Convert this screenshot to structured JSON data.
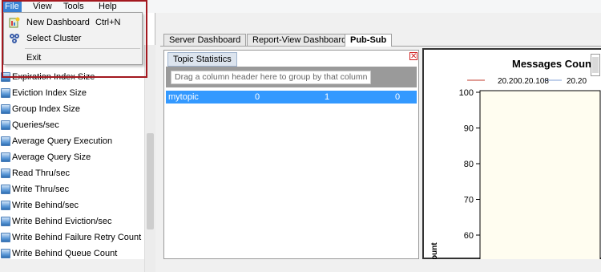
{
  "menubar": {
    "items": [
      "File",
      "View",
      "Tools",
      "Help"
    ]
  },
  "file_menu": {
    "items": [
      {
        "label": "New Dashboard",
        "shortcut": "Ctrl+N",
        "icon": "new-dashboard-icon"
      },
      {
        "label": "Select Cluster",
        "shortcut": "",
        "icon": "cluster-icon"
      },
      {
        "label": "Exit",
        "shortcut": "",
        "icon": ""
      }
    ]
  },
  "counters": {
    "items": [
      "Expiration Index Size",
      "Eviction Index Size",
      "Group Index Size",
      "Queries/sec",
      "Average Query Execution",
      "Average Query Size",
      "Read Thru/sec",
      "Write Thru/sec",
      "Write Behind/sec",
      "Write Behind Eviction/sec",
      "Write Behind Failure Retry Count",
      "Write Behind Queue Count"
    ]
  },
  "tabs": [
    "Server Dashboard",
    "Report-View Dashboard",
    "Pub-Sub"
  ],
  "topic_stats": {
    "title": "Topic Statistics",
    "group_hint": "Drag a column header here to group by that column",
    "rows": [
      {
        "topic": "mytopic",
        "c1": "0",
        "c2": "1",
        "c3": "0"
      }
    ]
  },
  "chart_data": {
    "type": "line",
    "title": "Messages Count",
    "series": [
      {
        "name": "20.200.20.108",
        "color": "#c0392b",
        "values": []
      },
      {
        "name": "20.20",
        "color": "#7f9fd6",
        "values": []
      }
    ],
    "yticks": [
      "100",
      "90",
      "80",
      "70",
      "60"
    ],
    "ylim": [
      60,
      100
    ],
    "ylabel": "ount",
    "colors": {
      "plot_bg": "#fffdf0",
      "highlight": "#a3181f",
      "selection": "#3399ff"
    }
  }
}
